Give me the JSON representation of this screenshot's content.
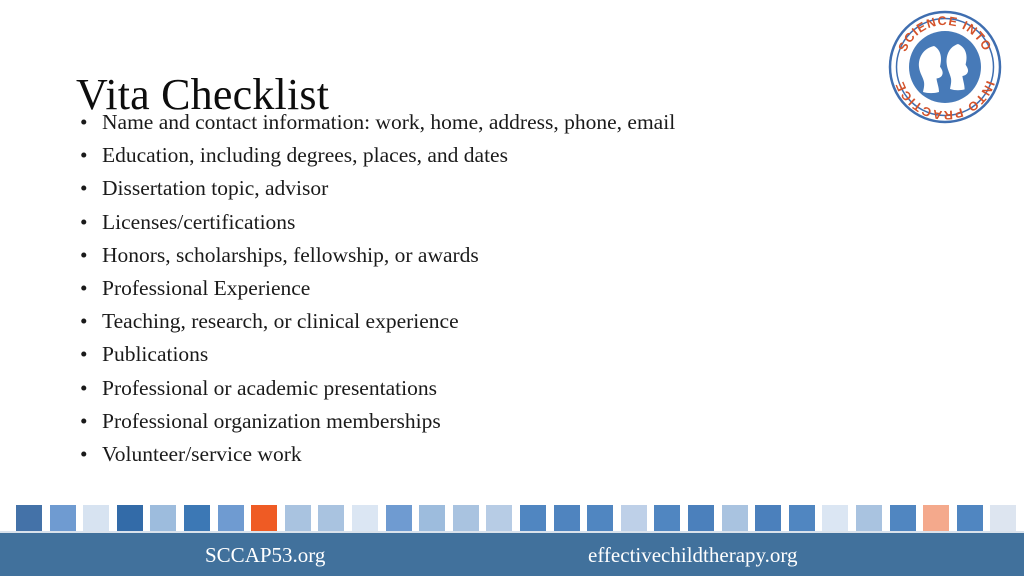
{
  "slide": {
    "title": "Vita Checklist",
    "background": "#ffffff",
    "text_color": "#1a1a1a"
  },
  "bullets": [
    {
      "text": "Name and contact information: work, home, address, phone, email",
      "marker": "•"
    },
    {
      "text": "Education, including degrees, places, and dates",
      "marker": "•"
    },
    {
      "text": "Dissertation topic, advisor",
      "marker": "•"
    },
    {
      "text": "Licenses/certifications",
      "marker": "•"
    },
    {
      "text": "Honors, scholarships, fellowship, or awards",
      "marker": "•"
    },
    {
      "text": "Professional Experience",
      "marker": "•"
    },
    {
      "text": "Teaching, research, or clinical experience",
      "marker": "•"
    },
    {
      "text": "Publications",
      "marker": "•"
    },
    {
      "text": "Professional or academic presentations",
      "marker": "•"
    },
    {
      "text": "Professional organization memberships",
      "marker": "•"
    },
    {
      "text": "Volunteer/service work",
      "marker": "•"
    }
  ],
  "logo": {
    "name": "science-into-practice-logo",
    "arc_text_top": "SCIENCE INTO",
    "arc_text_bottom": "INTO PRACTICE",
    "ring_color": "#3f6eb0",
    "text_color": "#d4522a",
    "face_color": "#477ab8"
  },
  "footer": {
    "bar_color": "#41719c",
    "left_label": "SCCAP53.org",
    "right_label": "effectivechildtherapy.org",
    "squares": [
      "#4472a8",
      "#6f9bd1",
      "#d7e3f1",
      "#336ba8",
      "#9dbcdd",
      "#3c78b5",
      "#6f9bd1",
      "#ef5b24",
      "#a9c3e0",
      "#a9c3e0",
      "#dbe6f3",
      "#6f9bd1",
      "#9dbcdd",
      "#a9c3e0",
      "#b7cce5",
      "#5086c1",
      "#4f84bf",
      "#5086c1",
      "#bed0e8",
      "#5086c1",
      "#4b80bc",
      "#a9c3e0",
      "#4b80bc",
      "#5086c1",
      "#dbe6f3",
      "#a9c3e0",
      "#5086c1",
      "#f4a98c",
      "#5086c1",
      "#dde5f0"
    ]
  }
}
